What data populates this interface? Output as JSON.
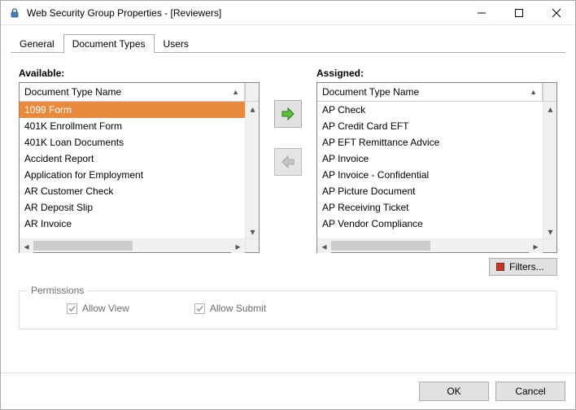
{
  "window": {
    "title": "Web Security Group Properties - [Reviewers]"
  },
  "tabs": [
    {
      "label": "General",
      "active": false
    },
    {
      "label": "Document Types",
      "active": true
    },
    {
      "label": "Users",
      "active": false
    }
  ],
  "available": {
    "label": "Available:",
    "header": "Document Type Name",
    "items": [
      "1099 Form",
      "401K Enrollment Form",
      "401K Loan Documents",
      "Accident Report",
      "Application for Employment",
      "AR Customer Check",
      "AR Deposit Slip",
      "AR Invoice"
    ],
    "selected_index": 0
  },
  "assigned": {
    "label": "Assigned:",
    "header": "Document Type Name",
    "items": [
      "AP Check",
      "AP Credit Card EFT",
      "AP EFT Remittance Advice",
      "AP Invoice",
      "AP Invoice - Confidential",
      "AP Picture Document",
      "AP Receiving Ticket",
      "AP Vendor Compliance"
    ],
    "selected_index": -1
  },
  "buttons": {
    "filters": "Filters...",
    "ok": "OK",
    "cancel": "Cancel"
  },
  "permissions": {
    "legend": "Permissions",
    "allow_view_label": "Allow View",
    "allow_view_checked": true,
    "allow_submit_label": "Allow Submit",
    "allow_submit_checked": true
  }
}
